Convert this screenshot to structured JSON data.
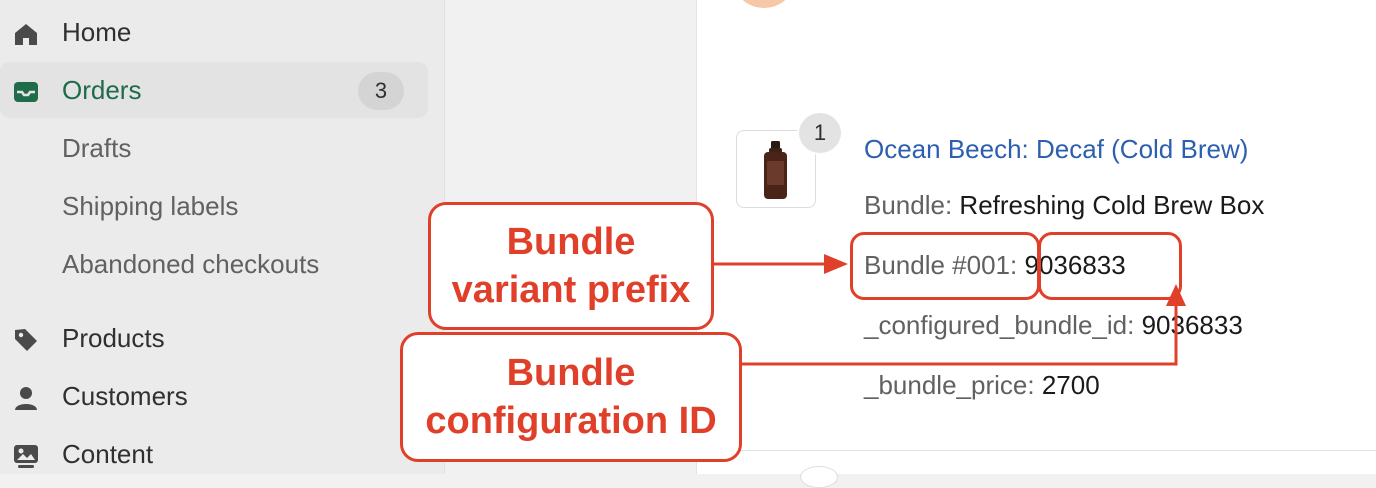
{
  "sidebar": {
    "items": [
      {
        "label": "Home",
        "icon": "home-icon"
      },
      {
        "label": "Orders",
        "icon": "inbox-icon",
        "badge": "3",
        "active": true
      },
      {
        "label": "Drafts"
      },
      {
        "label": "Shipping labels"
      },
      {
        "label": "Abandoned checkouts"
      },
      {
        "label": "Products",
        "icon": "tag-icon"
      },
      {
        "label": "Customers",
        "icon": "person-icon"
      },
      {
        "label": "Content",
        "icon": "image-icon"
      }
    ]
  },
  "line_item": {
    "quantity": "1",
    "product_title": "Ocean Beech: Decaf (Cold Brew)",
    "properties": [
      {
        "key": "Bundle:",
        "value": "Refreshing Cold Brew Box"
      },
      {
        "key": "Bundle #001:",
        "value": "9036833"
      },
      {
        "key": "_configured_bundle_id:",
        "value": "9036833"
      },
      {
        "key": "_bundle_price:",
        "value": "2700"
      }
    ]
  },
  "annotations": {
    "variant_prefix": [
      "Bundle",
      "variant prefix"
    ],
    "configuration_id": [
      "Bundle",
      "configuration ID"
    ]
  },
  "colors": {
    "accent_green": "#1f6b4a",
    "link_blue": "#2c5fb0",
    "annotation_red": "#e0402a"
  }
}
